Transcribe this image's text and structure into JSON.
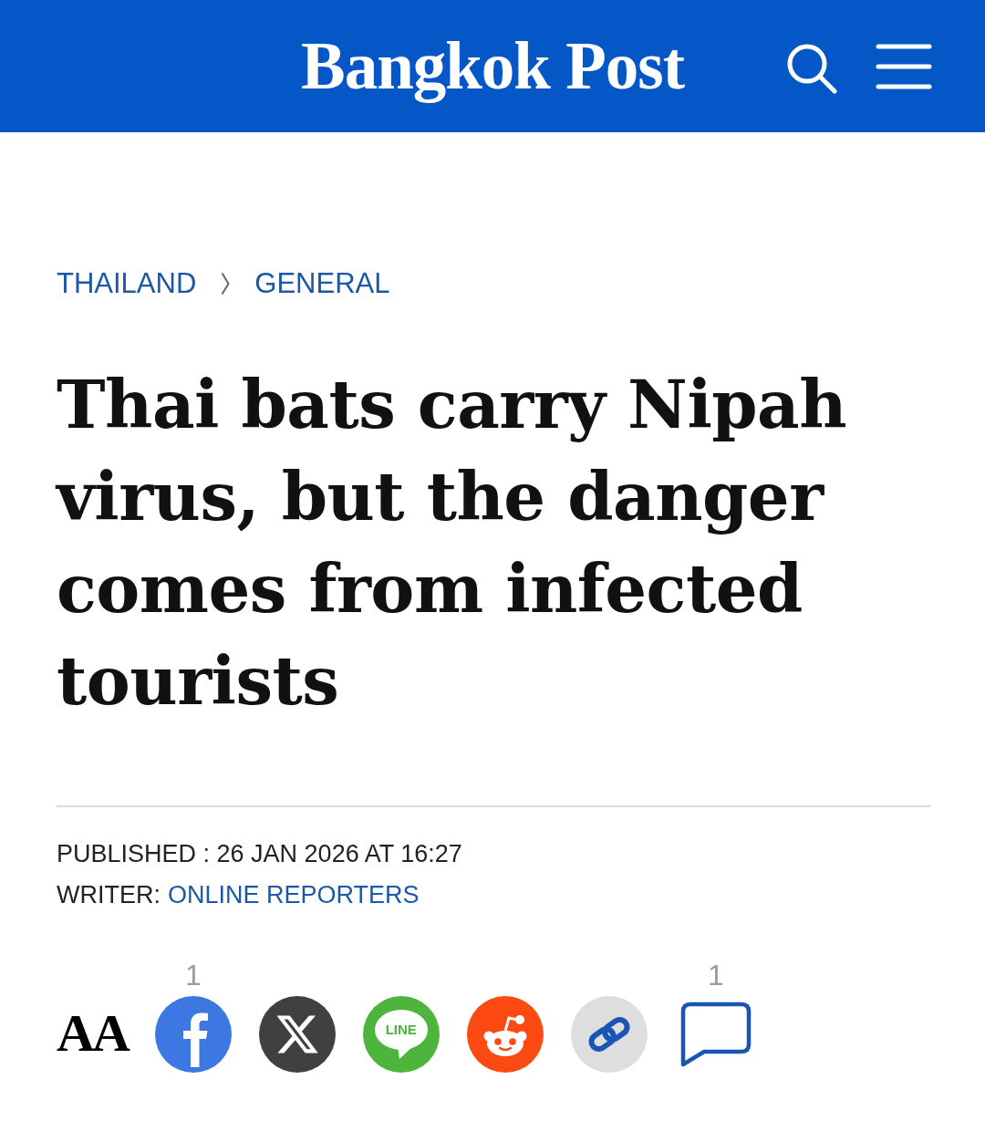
{
  "header": {
    "logo": "Bangkok Post"
  },
  "breadcrumb": [
    {
      "label": "THAILAND"
    },
    {
      "label": "GENERAL"
    }
  ],
  "headline": "Thai bats carry Nipah virus, but the danger comes from infected tourists",
  "meta": {
    "published": "PUBLISHED : 26 JAN 2026 AT 16:27",
    "writer_label": "WRITER:",
    "writer": "ONLINE REPORTERS"
  },
  "share": [
    {
      "kind": "text-size",
      "label": "AA"
    },
    {
      "kind": "facebook",
      "count": "1"
    },
    {
      "kind": "x"
    },
    {
      "kind": "line",
      "label": "LINE"
    },
    {
      "kind": "reddit"
    },
    {
      "kind": "copy-link"
    },
    {
      "kind": "comments",
      "count": "1"
    }
  ]
}
